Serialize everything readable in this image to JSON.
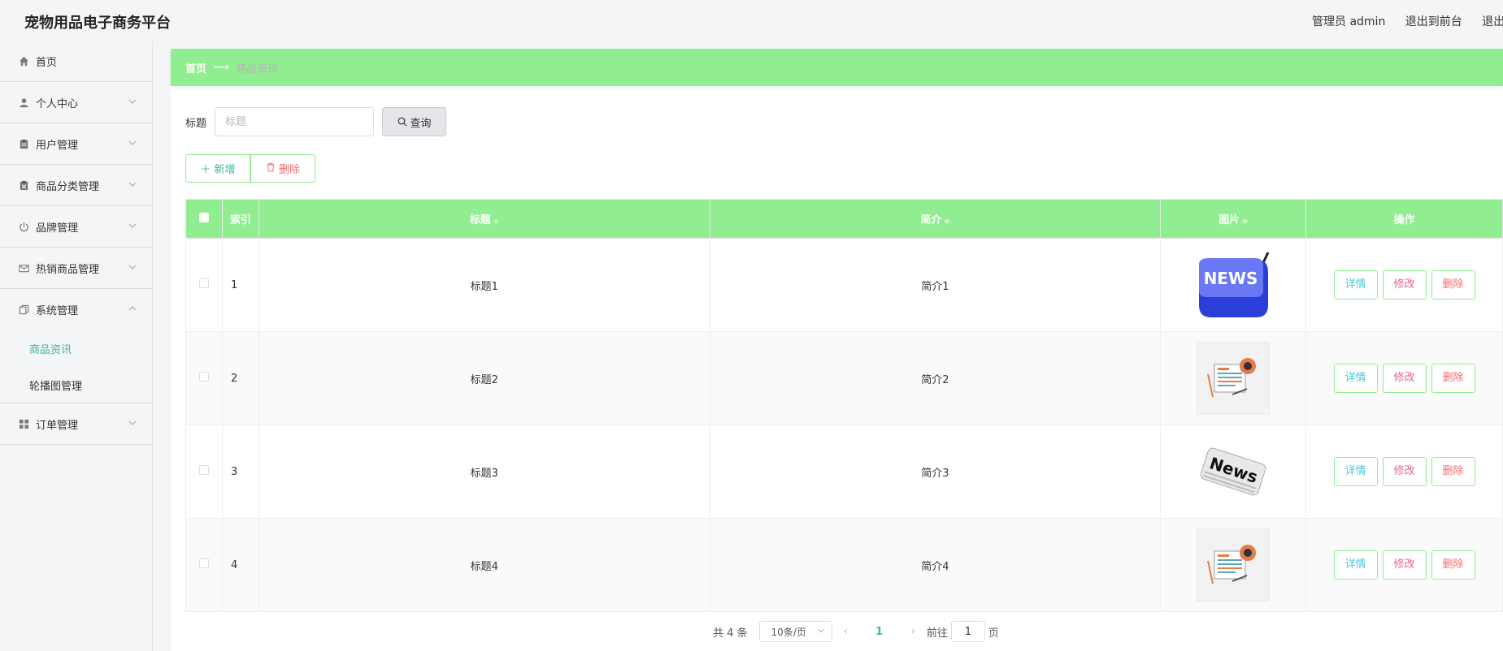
{
  "header": {
    "title": "宠物用品电子商务平台",
    "admin_label": "管理员 admin",
    "back_front": "退出到前台",
    "logout": "退出"
  },
  "sidebar": {
    "items": [
      {
        "label": "首页",
        "icon": "home-icon"
      },
      {
        "label": "个人中心",
        "icon": "user-icon"
      },
      {
        "label": "用户管理",
        "icon": "clipboard-icon"
      },
      {
        "label": "商品分类管理",
        "icon": "clipboard-x-icon"
      },
      {
        "label": "品牌管理",
        "icon": "power-icon"
      },
      {
        "label": "热销商品管理",
        "icon": "mail-icon"
      },
      {
        "label": "系统管理",
        "icon": "copy-icon"
      },
      {
        "label": "订单管理",
        "icon": "grid-icon"
      }
    ],
    "sub_items": [
      {
        "label": "商品资讯",
        "active": true
      },
      {
        "label": "轮播图管理",
        "active": false
      }
    ]
  },
  "breadcrumb": {
    "home": "首页",
    "current": "商品资讯"
  },
  "search": {
    "label": "标题",
    "placeholder": "标题",
    "button": "查询"
  },
  "actions": {
    "add": "新增",
    "delete": "删除"
  },
  "table": {
    "columns": {
      "index": "索引",
      "title": "标题",
      "intro": "简介",
      "image": "图片",
      "ops": "操作"
    },
    "ops": {
      "detail": "详情",
      "edit": "修改",
      "delete": "删除"
    },
    "rows": [
      {
        "index": "1",
        "title": "标题1",
        "intro": "简介1",
        "image": "news-key-image"
      },
      {
        "index": "2",
        "title": "标题2",
        "intro": "简介2",
        "image": "newspaper-illustration-image"
      },
      {
        "index": "3",
        "title": "标题3",
        "intro": "简介3",
        "image": "newspaper-roll-image"
      },
      {
        "index": "4",
        "title": "标题4",
        "intro": "简介4",
        "image": "newspaper-illustration-image"
      }
    ]
  },
  "pagination": {
    "total": "共 4 条",
    "page_size": "10条/页",
    "current_page": "1",
    "goto_label": "前往",
    "goto_value": "1",
    "page_suffix": "页"
  },
  "colors": {
    "accent": "#90ee90",
    "active_text": "#3cb8a0",
    "danger": "#f56c6c"
  }
}
